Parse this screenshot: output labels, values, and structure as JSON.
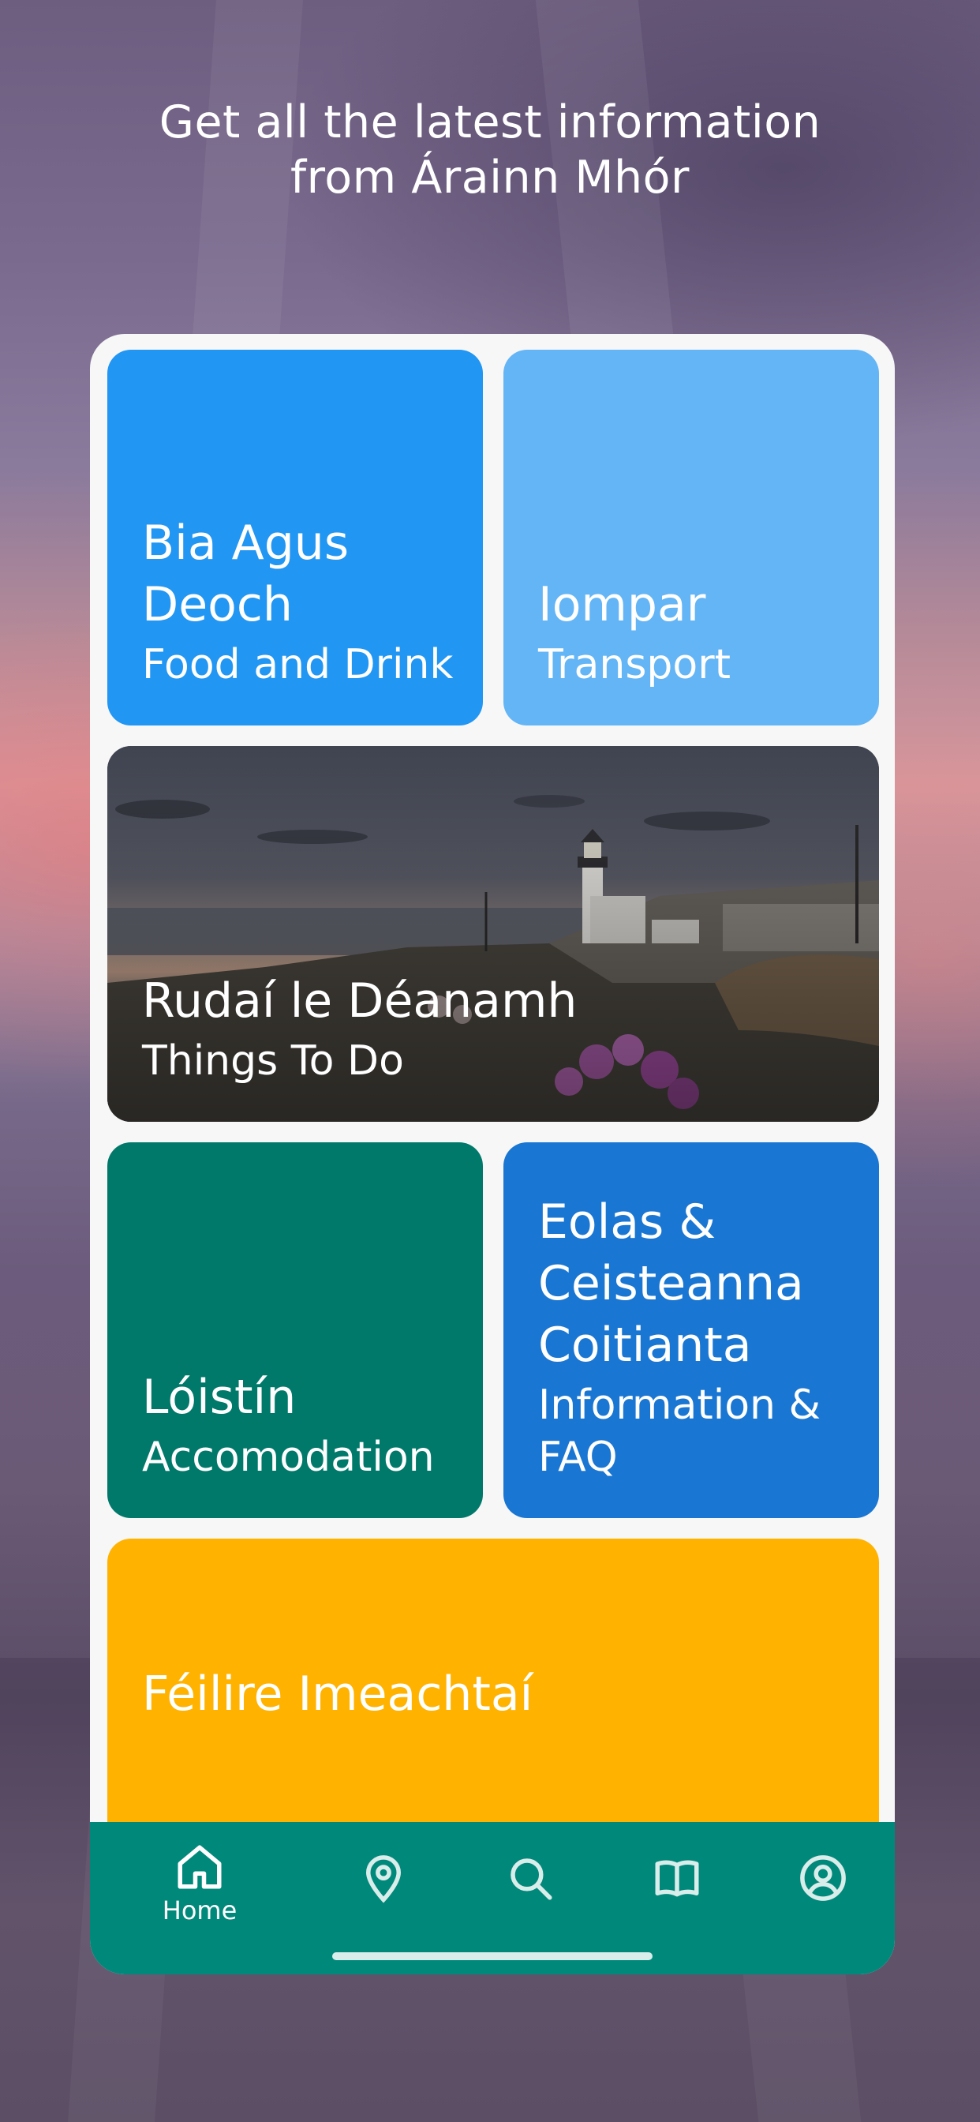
{
  "header": {
    "line1": "Get all the latest information",
    "line2": "from Árainn Mhór"
  },
  "tiles": [
    {
      "title": "Bia Agus Deoch",
      "subtitle": "Food and Drink",
      "color": "#2196f3"
    },
    {
      "title": "Iompar",
      "subtitle": "Transport",
      "color": "#64b5f6"
    },
    {
      "title": "Rudaí le Déanamh",
      "subtitle": "Things To Do",
      "image": "lighthouse-coast-photo"
    },
    {
      "title": "Lóistín",
      "subtitle": "Accomodation",
      "color": "#00796b"
    },
    {
      "title": "Eolas & Ceisteanna Coitianta",
      "subtitle": "Information & FAQ",
      "color": "#1976d2"
    },
    {
      "title": "Féilire Imeachtaí",
      "subtitle": "",
      "color": "#ffb300"
    }
  ],
  "nav": {
    "background": "#00897b",
    "items": [
      {
        "icon": "home-icon",
        "label": "Home",
        "active": true
      },
      {
        "icon": "map-pin-icon",
        "label": ""
      },
      {
        "icon": "search-icon",
        "label": ""
      },
      {
        "icon": "book-icon",
        "label": ""
      },
      {
        "icon": "profile-icon",
        "label": ""
      }
    ]
  }
}
